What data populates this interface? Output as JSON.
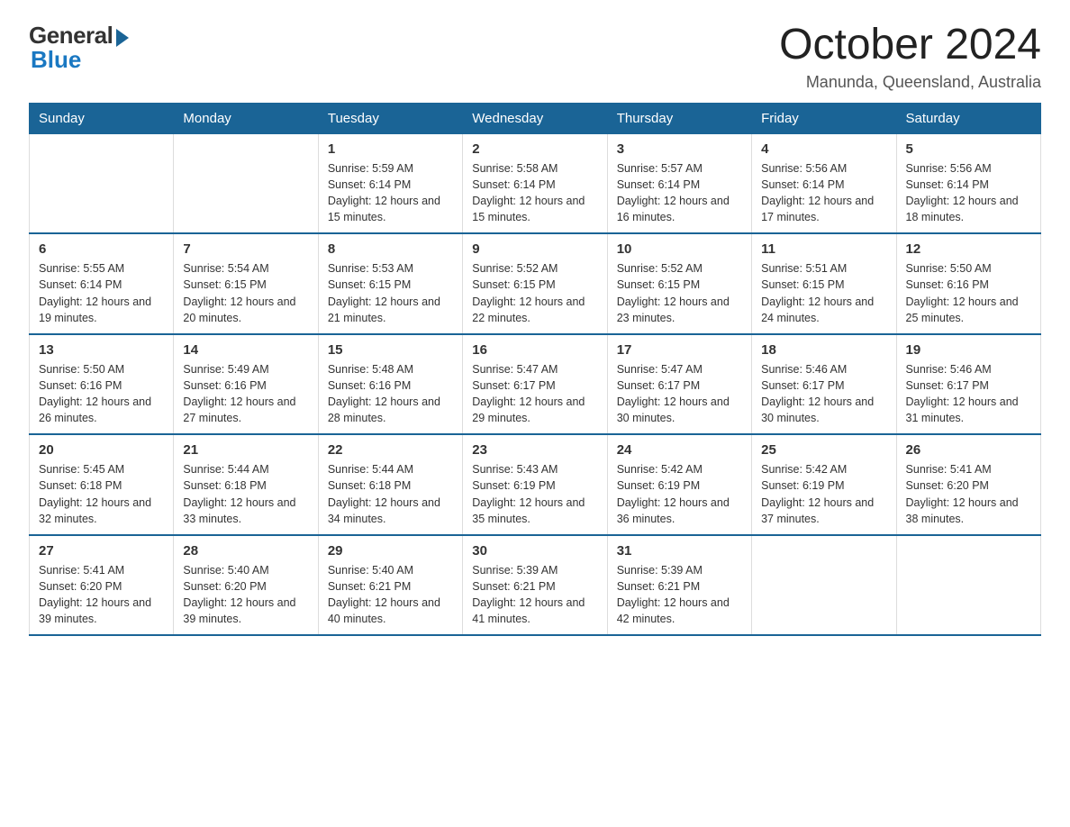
{
  "logo": {
    "general": "General",
    "blue": "Blue"
  },
  "title": "October 2024",
  "subtitle": "Manunda, Queensland, Australia",
  "days_of_week": [
    "Sunday",
    "Monday",
    "Tuesday",
    "Wednesday",
    "Thursday",
    "Friday",
    "Saturday"
  ],
  "weeks": [
    [
      {
        "day": "",
        "info": ""
      },
      {
        "day": "",
        "info": ""
      },
      {
        "day": "1",
        "info": "Sunrise: 5:59 AM\nSunset: 6:14 PM\nDaylight: 12 hours and 15 minutes."
      },
      {
        "day": "2",
        "info": "Sunrise: 5:58 AM\nSunset: 6:14 PM\nDaylight: 12 hours and 15 minutes."
      },
      {
        "day": "3",
        "info": "Sunrise: 5:57 AM\nSunset: 6:14 PM\nDaylight: 12 hours and 16 minutes."
      },
      {
        "day": "4",
        "info": "Sunrise: 5:56 AM\nSunset: 6:14 PM\nDaylight: 12 hours and 17 minutes."
      },
      {
        "day": "5",
        "info": "Sunrise: 5:56 AM\nSunset: 6:14 PM\nDaylight: 12 hours and 18 minutes."
      }
    ],
    [
      {
        "day": "6",
        "info": "Sunrise: 5:55 AM\nSunset: 6:14 PM\nDaylight: 12 hours and 19 minutes."
      },
      {
        "day": "7",
        "info": "Sunrise: 5:54 AM\nSunset: 6:15 PM\nDaylight: 12 hours and 20 minutes."
      },
      {
        "day": "8",
        "info": "Sunrise: 5:53 AM\nSunset: 6:15 PM\nDaylight: 12 hours and 21 minutes."
      },
      {
        "day": "9",
        "info": "Sunrise: 5:52 AM\nSunset: 6:15 PM\nDaylight: 12 hours and 22 minutes."
      },
      {
        "day": "10",
        "info": "Sunrise: 5:52 AM\nSunset: 6:15 PM\nDaylight: 12 hours and 23 minutes."
      },
      {
        "day": "11",
        "info": "Sunrise: 5:51 AM\nSunset: 6:15 PM\nDaylight: 12 hours and 24 minutes."
      },
      {
        "day": "12",
        "info": "Sunrise: 5:50 AM\nSunset: 6:16 PM\nDaylight: 12 hours and 25 minutes."
      }
    ],
    [
      {
        "day": "13",
        "info": "Sunrise: 5:50 AM\nSunset: 6:16 PM\nDaylight: 12 hours and 26 minutes."
      },
      {
        "day": "14",
        "info": "Sunrise: 5:49 AM\nSunset: 6:16 PM\nDaylight: 12 hours and 27 minutes."
      },
      {
        "day": "15",
        "info": "Sunrise: 5:48 AM\nSunset: 6:16 PM\nDaylight: 12 hours and 28 minutes."
      },
      {
        "day": "16",
        "info": "Sunrise: 5:47 AM\nSunset: 6:17 PM\nDaylight: 12 hours and 29 minutes."
      },
      {
        "day": "17",
        "info": "Sunrise: 5:47 AM\nSunset: 6:17 PM\nDaylight: 12 hours and 30 minutes."
      },
      {
        "day": "18",
        "info": "Sunrise: 5:46 AM\nSunset: 6:17 PM\nDaylight: 12 hours and 30 minutes."
      },
      {
        "day": "19",
        "info": "Sunrise: 5:46 AM\nSunset: 6:17 PM\nDaylight: 12 hours and 31 minutes."
      }
    ],
    [
      {
        "day": "20",
        "info": "Sunrise: 5:45 AM\nSunset: 6:18 PM\nDaylight: 12 hours and 32 minutes."
      },
      {
        "day": "21",
        "info": "Sunrise: 5:44 AM\nSunset: 6:18 PM\nDaylight: 12 hours and 33 minutes."
      },
      {
        "day": "22",
        "info": "Sunrise: 5:44 AM\nSunset: 6:18 PM\nDaylight: 12 hours and 34 minutes."
      },
      {
        "day": "23",
        "info": "Sunrise: 5:43 AM\nSunset: 6:19 PM\nDaylight: 12 hours and 35 minutes."
      },
      {
        "day": "24",
        "info": "Sunrise: 5:42 AM\nSunset: 6:19 PM\nDaylight: 12 hours and 36 minutes."
      },
      {
        "day": "25",
        "info": "Sunrise: 5:42 AM\nSunset: 6:19 PM\nDaylight: 12 hours and 37 minutes."
      },
      {
        "day": "26",
        "info": "Sunrise: 5:41 AM\nSunset: 6:20 PM\nDaylight: 12 hours and 38 minutes."
      }
    ],
    [
      {
        "day": "27",
        "info": "Sunrise: 5:41 AM\nSunset: 6:20 PM\nDaylight: 12 hours and 39 minutes."
      },
      {
        "day": "28",
        "info": "Sunrise: 5:40 AM\nSunset: 6:20 PM\nDaylight: 12 hours and 39 minutes."
      },
      {
        "day": "29",
        "info": "Sunrise: 5:40 AM\nSunset: 6:21 PM\nDaylight: 12 hours and 40 minutes."
      },
      {
        "day": "30",
        "info": "Sunrise: 5:39 AM\nSunset: 6:21 PM\nDaylight: 12 hours and 41 minutes."
      },
      {
        "day": "31",
        "info": "Sunrise: 5:39 AM\nSunset: 6:21 PM\nDaylight: 12 hours and 42 minutes."
      },
      {
        "day": "",
        "info": ""
      },
      {
        "day": "",
        "info": ""
      }
    ]
  ]
}
